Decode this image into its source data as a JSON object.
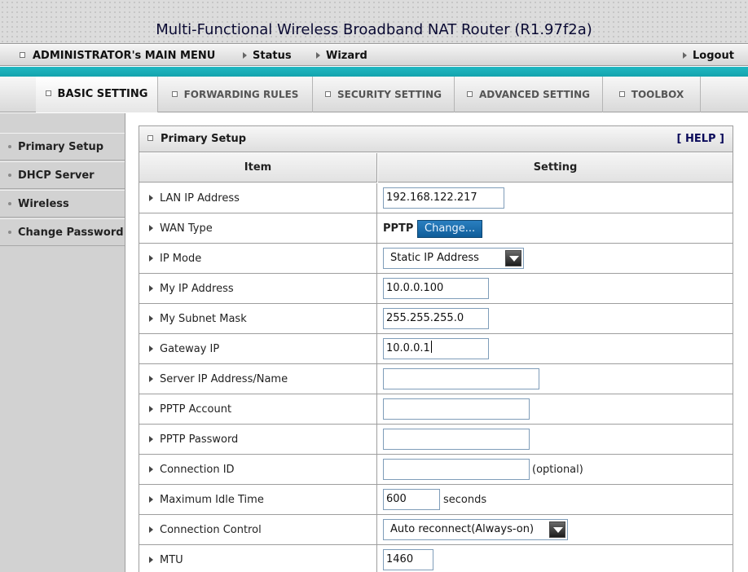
{
  "header": {
    "title": "Multi-Functional Wireless Broadband NAT Router (R1.97f2a)"
  },
  "mainmenu": {
    "admin": "ADMINISTRATOR's MAIN MENU",
    "status": "Status",
    "wizard": "Wizard",
    "logout": "Logout"
  },
  "tabs": [
    {
      "label": "BASIC SETTING",
      "active": true
    },
    {
      "label": "FORWARDING RULES",
      "active": false
    },
    {
      "label": "SECURITY SETTING",
      "active": false
    },
    {
      "label": "ADVANCED SETTING",
      "active": false
    },
    {
      "label": "TOOLBOX",
      "active": false
    }
  ],
  "sidebar": {
    "items": [
      {
        "label": "Primary Setup"
      },
      {
        "label": "DHCP Server"
      },
      {
        "label": "Wireless"
      },
      {
        "label": "Change Password"
      }
    ]
  },
  "panel": {
    "title": "Primary Setup",
    "help": "[ HELP ]",
    "col_item": "Item",
    "col_setting": "Setting"
  },
  "rows": {
    "lan_ip": {
      "label": "LAN IP Address",
      "value": "192.168.122.217"
    },
    "wan_type": {
      "label": "WAN Type",
      "value": "PPTP",
      "button": "Change..."
    },
    "ip_mode": {
      "label": "IP Mode",
      "value": "Static IP Address"
    },
    "my_ip": {
      "label": "My IP Address",
      "value": "10.0.0.100"
    },
    "subnet": {
      "label": "My Subnet Mask",
      "value": "255.255.255.0"
    },
    "gateway": {
      "label": "Gateway IP",
      "value": "10.0.0.1"
    },
    "server": {
      "label": "Server IP Address/Name",
      "value": ""
    },
    "account": {
      "label": "PPTP Account",
      "value": ""
    },
    "password": {
      "label": "PPTP Password",
      "value": ""
    },
    "conn_id": {
      "label": "Connection ID",
      "value": "",
      "suffix": "(optional)"
    },
    "idle": {
      "label": "Maximum Idle Time",
      "value": "600",
      "suffix": "seconds"
    },
    "control": {
      "label": "Connection Control",
      "value": "Auto reconnect(Always-on)"
    },
    "mtu": {
      "label": "MTU",
      "value": "1460"
    }
  }
}
